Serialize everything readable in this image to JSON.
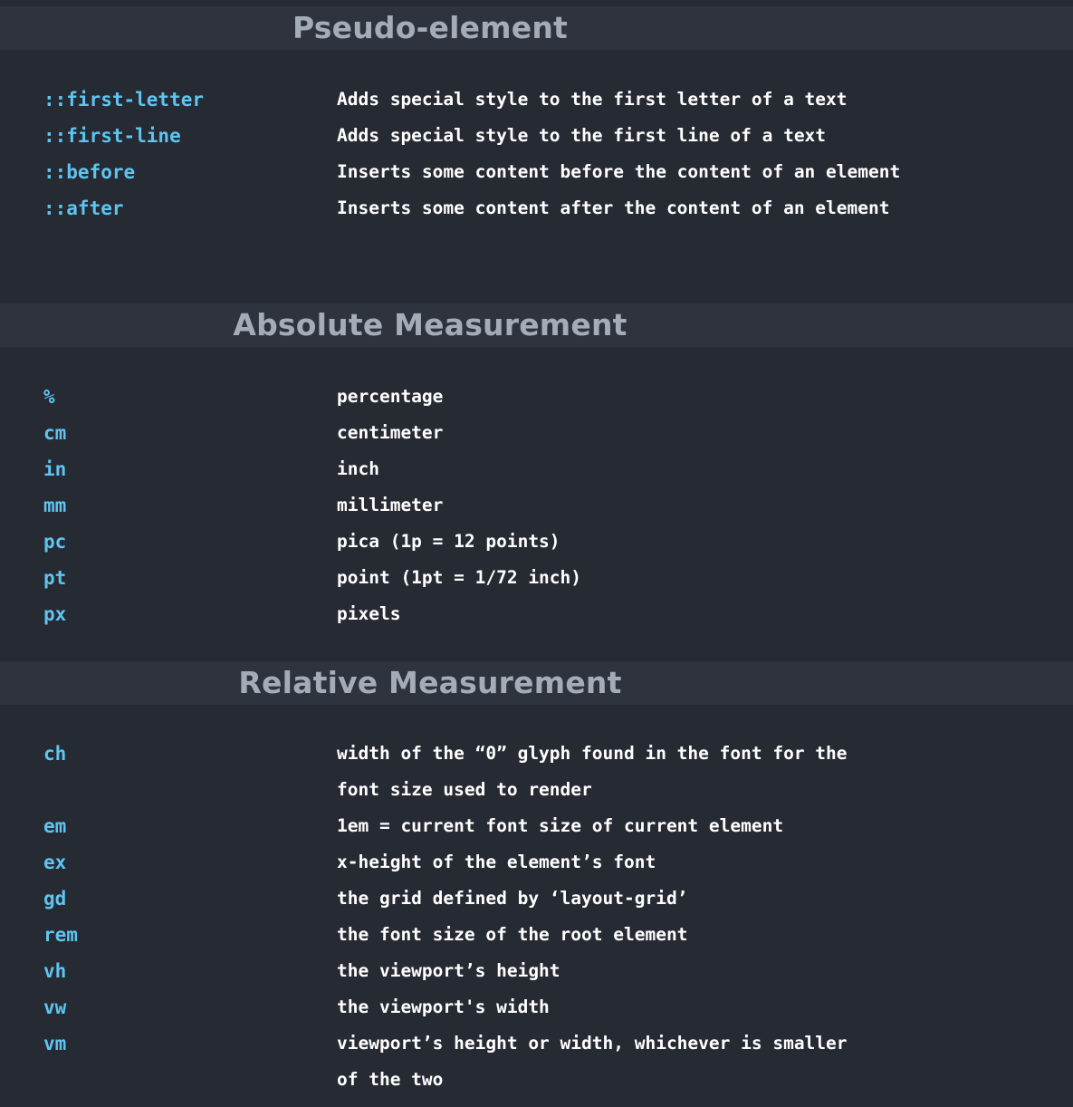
{
  "sections": [
    {
      "title": "Pseudo-element",
      "rows": [
        {
          "key": "::first-letter",
          "desc": [
            "Adds special style to the first letter of a text"
          ]
        },
        {
          "key": "::first-line",
          "desc": [
            "Adds special style to the first line of a text"
          ]
        },
        {
          "key": "::before",
          "desc": [
            "Inserts some content before the content of an element"
          ]
        },
        {
          "key": "::after",
          "desc": [
            "Inserts some content after the content of an element"
          ]
        }
      ]
    },
    {
      "title": "Absolute Measurement",
      "rows": [
        {
          "key": "%",
          "desc": [
            "percentage"
          ]
        },
        {
          "key": "cm",
          "desc": [
            "centimeter"
          ]
        },
        {
          "key": "in",
          "desc": [
            "inch"
          ]
        },
        {
          "key": "mm",
          "desc": [
            "millimeter"
          ]
        },
        {
          "key": "pc",
          "desc": [
            "pica (1p = 12 points)"
          ]
        },
        {
          "key": "pt",
          "desc": [
            "point (1pt = 1/72 inch)"
          ]
        },
        {
          "key": "px",
          "desc": [
            "pixels"
          ]
        }
      ]
    },
    {
      "title": "Relative Measurement",
      "rows": [
        {
          "key": "ch",
          "desc": [
            "width of the “0” glyph found in the font for the",
            "font size used to render"
          ]
        },
        {
          "key": "em",
          "desc": [
            "1em = current font size of current element"
          ]
        },
        {
          "key": "ex",
          "desc": [
            "x-height of the element’s font"
          ]
        },
        {
          "key": "gd",
          "desc": [
            "the grid defined by ‘layout-grid’"
          ]
        },
        {
          "key": "rem",
          "desc": [
            "the font size of the root element"
          ]
        },
        {
          "key": "vh",
          "desc": [
            "the viewport’s height"
          ]
        },
        {
          "key": "vw",
          "desc": [
            "the viewport's width"
          ]
        },
        {
          "key": "vm",
          "desc": [
            "viewport’s height or width, whichever is smaller",
            "of the two"
          ]
        }
      ]
    }
  ]
}
